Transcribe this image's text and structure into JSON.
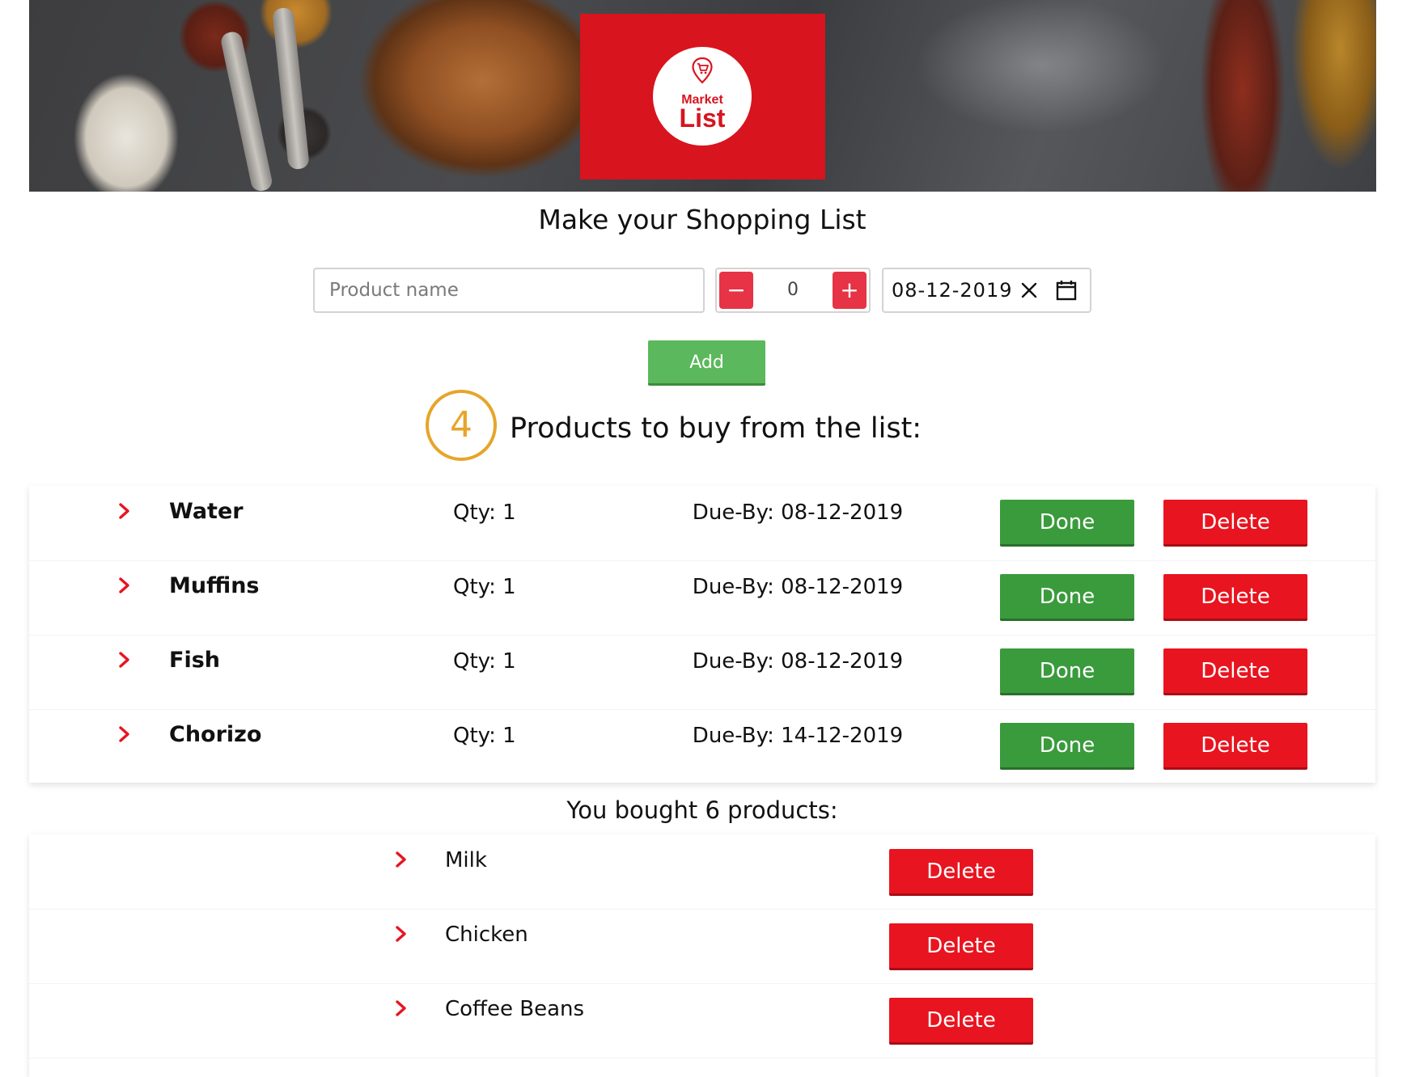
{
  "banner": {
    "logo": {
      "line1": "Market",
      "line2": "List"
    }
  },
  "page_title": "Make your Shopping List",
  "form": {
    "product_placeholder": "Product name",
    "product_value": "",
    "quantity": "0",
    "minus_label": "−",
    "plus_label": "+",
    "date": "08-12-2019",
    "add_label": "Add"
  },
  "pending": {
    "count": "4",
    "title": "Products to buy from the list:",
    "done_label": "Done",
    "delete_label": "Delete",
    "items": [
      {
        "name": "Water",
        "qty": "Qty: 1",
        "due": "Due-By: 08-12-2019"
      },
      {
        "name": "Muffins",
        "qty": "Qty: 1",
        "due": "Due-By: 08-12-2019"
      },
      {
        "name": "Fish",
        "qty": "Qty: 1",
        "due": "Due-By: 08-12-2019"
      },
      {
        "name": "Chorizo",
        "qty": "Qty: 1",
        "due": "Due-By: 14-12-2019"
      }
    ]
  },
  "bought": {
    "title": "You bought 6 products:",
    "delete_label": "Delete",
    "items": [
      {
        "name": "Milk"
      },
      {
        "name": "Chicken"
      },
      {
        "name": "Coffee Beans"
      }
    ]
  },
  "colors": {
    "brand_red": "#d8141e",
    "delete_red": "#e8141f",
    "done_green": "#3a9b3c",
    "add_green": "#5cb85c",
    "badge_orange": "#e6a52a",
    "stepper_red": "#e63346"
  },
  "icons": {
    "chevron": "chevron-right-icon",
    "clear": "close-icon",
    "calendar": "calendar-icon",
    "logo_pin": "cart-pin-icon"
  }
}
